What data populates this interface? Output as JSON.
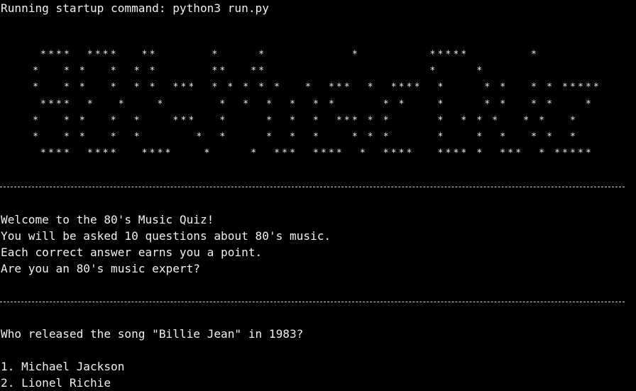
{
  "terminal": {
    "startup_line": "Running startup command: python3 run.py",
    "ascii_art_rows": [
      " ****  ****   **       *     *           *         *****        *",
      "*   * *   *  * *       **   **                     *     *",
      "*   * *   *  * *  ***  * * * * *   *  ***  *  ****  *     * *   * * *****",
      " ****  *   *    *       *  *  *  *  * *      * *    *     * *   * *    *",
      "*   * *   *  *    ***   *     *  *  *  *** * *      *  * * *   * *   *",
      "*   * *   *  *       *  *     *  *  *    * * *      *    *  *   * *  *",
      " ****  ****   ****    *     *  ***  ****  *  ****   **** *  ***  * *****"
    ],
    "separator": "------------------------------------------------------------------------------------------",
    "welcome_lines": [
      "Welcome to the 80's Music Quiz!",
      "You will be asked 10 questions about 80's music.",
      "Each correct answer earns you a point.",
      "Are you an 80's music expert?"
    ],
    "question": "Who released the song \"Billie Jean\" in 1983?",
    "options": [
      "1. Michael Jackson",
      "2. Lionel Richie"
    ],
    "colors": {
      "background": "#000000",
      "foreground": "#f0f0f0"
    }
  }
}
